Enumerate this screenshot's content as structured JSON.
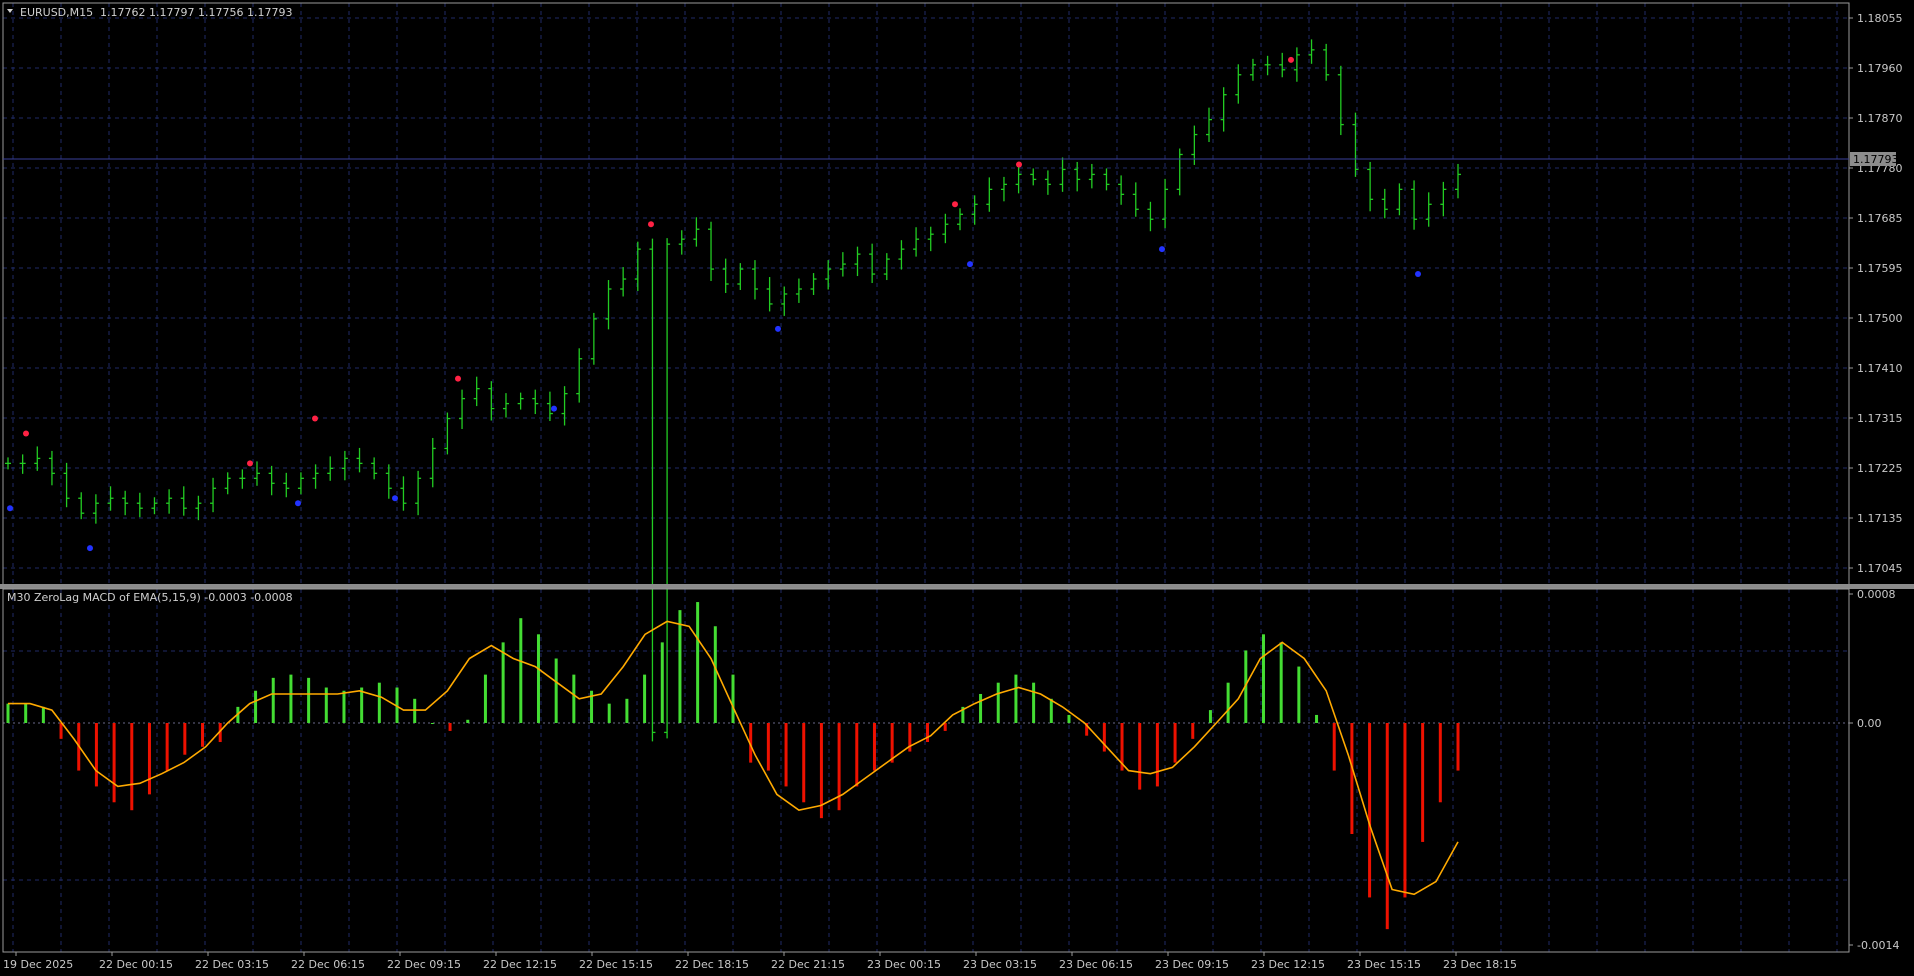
{
  "header": {
    "symbol": "EURUSD,M15",
    "quote": "1.17762 1.17797 1.17756 1.17793",
    "indicator": "M30 ZeroLag MACD of EMA(5,15,9) -0.0003 -0.0008"
  },
  "current_price_label": "1.17793",
  "colors": {
    "background": "#000000",
    "bull_bar": "#22cc22",
    "macd_pos": "#44dd33",
    "macd_neg": "#ee1100",
    "signal": "#ffaa00",
    "grid": "#1f2a66",
    "fractal_up": "#ff2244",
    "fractal_down": "#2233ff"
  },
  "price_axis": {
    "ticks": [
      "1.18055",
      "1.17960",
      "1.17870",
      "1.17780",
      "1.17685",
      "1.17595",
      "1.17500",
      "1.17410",
      "1.17315",
      "1.17225",
      "1.17135",
      "1.17045"
    ]
  },
  "macd_axis": {
    "ticks": [
      "0.0008",
      "0.00",
      "-0.0014"
    ]
  },
  "time_axis": {
    "labels": [
      "19 Dec 2025",
      "22 Dec 00:15",
      "22 Dec 03:15",
      "22 Dec 06:15",
      "22 Dec 09:15",
      "22 Dec 12:15",
      "22 Dec 15:15",
      "22 Dec 18:15",
      "22 Dec 21:15",
      "23 Dec 00:15",
      "23 Dec 03:15",
      "23 Dec 06:15",
      "23 Dec 09:15",
      "23 Dec 12:15",
      "23 Dec 15:15",
      "23 Dec 18:15"
    ]
  },
  "chart_data": [
    {
      "type": "ohlc",
      "symbol": "EURUSD",
      "timeframe": "M15",
      "ylim": [
        1.17,
        1.1812
      ],
      "close_path": [
        1.1721,
        1.1721,
        1.1722,
        1.1719,
        1.1714,
        1.1711,
        1.1713,
        1.1714,
        1.1713,
        1.1712,
        1.1713,
        1.1714,
        1.1712,
        1.1713,
        1.1716,
        1.1718,
        1.1718,
        1.1719,
        1.1717,
        1.1716,
        1.1718,
        1.1719,
        1.172,
        1.1722,
        1.1721,
        1.1719,
        1.1716,
        1.1713,
        1.1718,
        1.1724,
        1.173,
        1.1734,
        1.1736,
        1.1732,
        1.1733,
        1.1734,
        1.1733,
        1.1731,
        1.1735,
        1.1742,
        1.175,
        1.1756,
        1.1758,
        1.1764,
        1.1667,
        1.1765,
        1.1766,
        1.1768,
        1.176,
        1.1757,
        1.176,
        1.1756,
        1.1753,
        1.1755,
        1.1756,
        1.1758,
        1.176,
        1.1761,
        1.1763,
        1.1759,
        1.1762,
        1.1764,
        1.1766,
        1.1767,
        1.1769,
        1.1771,
        1.1773,
        1.1776,
        1.1777,
        1.1779,
        1.1778,
        1.1777,
        1.178,
        1.1778,
        1.1779,
        1.1777,
        1.1775,
        1.1772,
        1.177,
        1.1776,
        1.1783,
        1.1787,
        1.179,
        1.1795,
        1.1799,
        1.1801,
        1.1801,
        1.18,
        1.1803,
        1.1804,
        1.1799,
        1.1789,
        1.178,
        1.1774,
        1.1772,
        1.1776,
        1.177,
        1.1773,
        1.1776,
        1.1779
      ],
      "fractals_up": [
        1.1727,
        1.1721,
        1.173,
        1.1738,
        1.1769,
        1.1773,
        1.1781,
        1.1802
      ],
      "fractals_down": [
        1.1712,
        1.1704,
        1.1713,
        1.1714,
        1.1732,
        1.1748,
        1.1761,
        1.1764,
        1.1759
      ]
    },
    {
      "type": "bar",
      "name": "M30 ZeroLag MACD of EMA(5,15,9)",
      "ylim": [
        -0.0014,
        0.0008
      ],
      "current": [
        -0.0003,
        -0.0008
      ],
      "histogram": [
        0.00012,
        0.00012,
        0.0001,
        -0.0001,
        -0.0003,
        -0.0004,
        -0.0005,
        -0.00055,
        -0.00045,
        -0.0003,
        -0.0002,
        -0.00015,
        -0.00012,
        0.0001,
        0.0002,
        0.00028,
        0.0003,
        0.00028,
        0.00022,
        0.0002,
        0.00022,
        0.00025,
        0.00022,
        0.00015,
        0.0,
        -5e-05,
        2e-05,
        0.0003,
        0.0005,
        0.00065,
        0.00055,
        0.0004,
        0.0003,
        0.0002,
        0.00012,
        0.00015,
        0.0003,
        0.0005,
        0.0007,
        0.00075,
        0.0006,
        0.0003,
        -0.00025,
        -0.0003,
        -0.0004,
        -0.0005,
        -0.0006,
        -0.00055,
        -0.0004,
        -0.0003,
        -0.00025,
        -0.00018,
        -0.00012,
        -5e-05,
        0.0001,
        0.00018,
        0.00025,
        0.0003,
        0.00025,
        0.00015,
        5e-05,
        -8e-05,
        -0.00018,
        -0.0003,
        -0.00042,
        -0.0004,
        -0.00025,
        -0.0001,
        8e-05,
        0.00025,
        0.00045,
        0.00055,
        0.0005,
        0.00035,
        5e-05,
        -0.0003,
        -0.0007,
        -0.0011,
        -0.0013,
        -0.0011,
        -0.00075,
        -0.0005,
        -0.0003
      ],
      "signal": [
        0.00012,
        0.00012,
        8e-05,
        -0.0001,
        -0.0003,
        -0.0004,
        -0.00038,
        -0.00032,
        -0.00025,
        -0.00015,
        0.0,
        0.00012,
        0.00018,
        0.00018,
        0.00018,
        0.00018,
        0.0002,
        0.00016,
        8e-05,
        8e-05,
        0.0002,
        0.0004,
        0.00048,
        0.0004,
        0.00035,
        0.00025,
        0.00015,
        0.00018,
        0.00035,
        0.00055,
        0.00063,
        0.0006,
        0.0004,
        0.0001,
        -0.0002,
        -0.00045,
        -0.00055,
        -0.00052,
        -0.00045,
        -0.00035,
        -0.00025,
        -0.00015,
        -8e-05,
        5e-05,
        0.00012,
        0.00018,
        0.00022,
        0.00018,
        0.0001,
        0.0,
        -0.00015,
        -0.0003,
        -0.00032,
        -0.00028,
        -0.00015,
        0.0,
        0.00015,
        0.0004,
        0.0005,
        0.0004,
        0.0002,
        -0.0002,
        -0.00065,
        -0.00105,
        -0.00108,
        -0.001,
        -0.00075
      ]
    }
  ]
}
